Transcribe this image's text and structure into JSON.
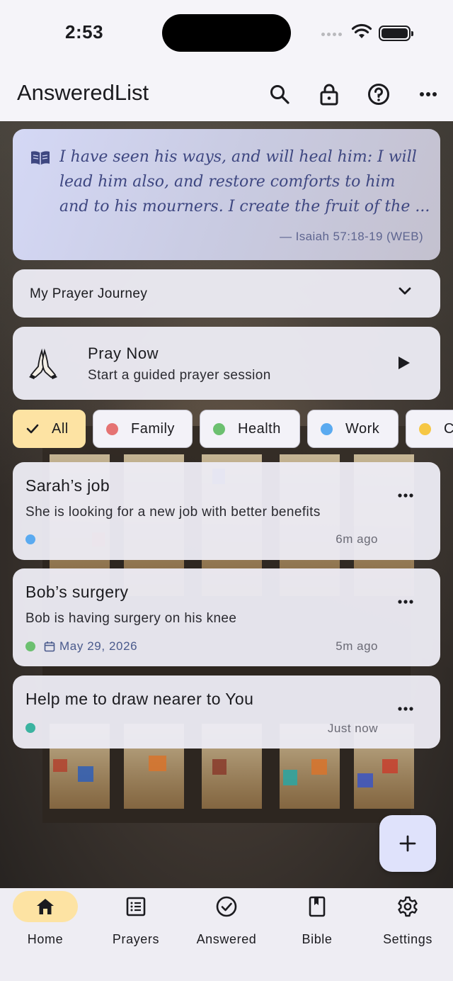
{
  "status_bar": {
    "time": "2:53"
  },
  "app_bar": {
    "title": "AnsweredList",
    "icons": [
      "search-icon",
      "lock-icon",
      "help-icon",
      "more-icon"
    ]
  },
  "verse": {
    "lines": [
      "I have seen his ways, and will heal him: I will",
      "lead him also, and restore comforts to him",
      "and to his mourners. I create the fruit of the ..."
    ],
    "reference": "— Isaiah 57:18-19 (WEB)"
  },
  "journey": {
    "label": "My Prayer Journey"
  },
  "pray_now": {
    "title": "Pray Now",
    "subtitle": "Start a guided prayer session"
  },
  "filters": [
    {
      "label": "All",
      "selected": true
    },
    {
      "label": "Family",
      "color": "#e57373"
    },
    {
      "label": "Health",
      "color": "#6cc070"
    },
    {
      "label": "Work",
      "color": "#5aaaf0"
    },
    {
      "label": "C",
      "color": "#f6c744"
    }
  ],
  "prayers": [
    {
      "title": "Sarah’s job",
      "description": "She is looking for a new job with better benefits",
      "color": "#5aaaf0",
      "time": "6m ago"
    },
    {
      "title": "Bob’s surgery",
      "description": "Bob is having surgery on his knee",
      "color": "#6cc070",
      "date": "May 29, 2026",
      "time": "5m ago"
    },
    {
      "title": "Help me to draw nearer to You",
      "color": "#3bb3a0",
      "time": "Just now"
    }
  ],
  "nav": {
    "items": [
      {
        "label": "Home",
        "icon": "home-icon",
        "active": true
      },
      {
        "label": "Prayers",
        "icon": "list-icon"
      },
      {
        "label": "Answered",
        "icon": "check-circle-icon"
      },
      {
        "label": "Bible",
        "icon": "book-icon"
      },
      {
        "label": "Settings",
        "icon": "gear-icon"
      }
    ]
  }
}
